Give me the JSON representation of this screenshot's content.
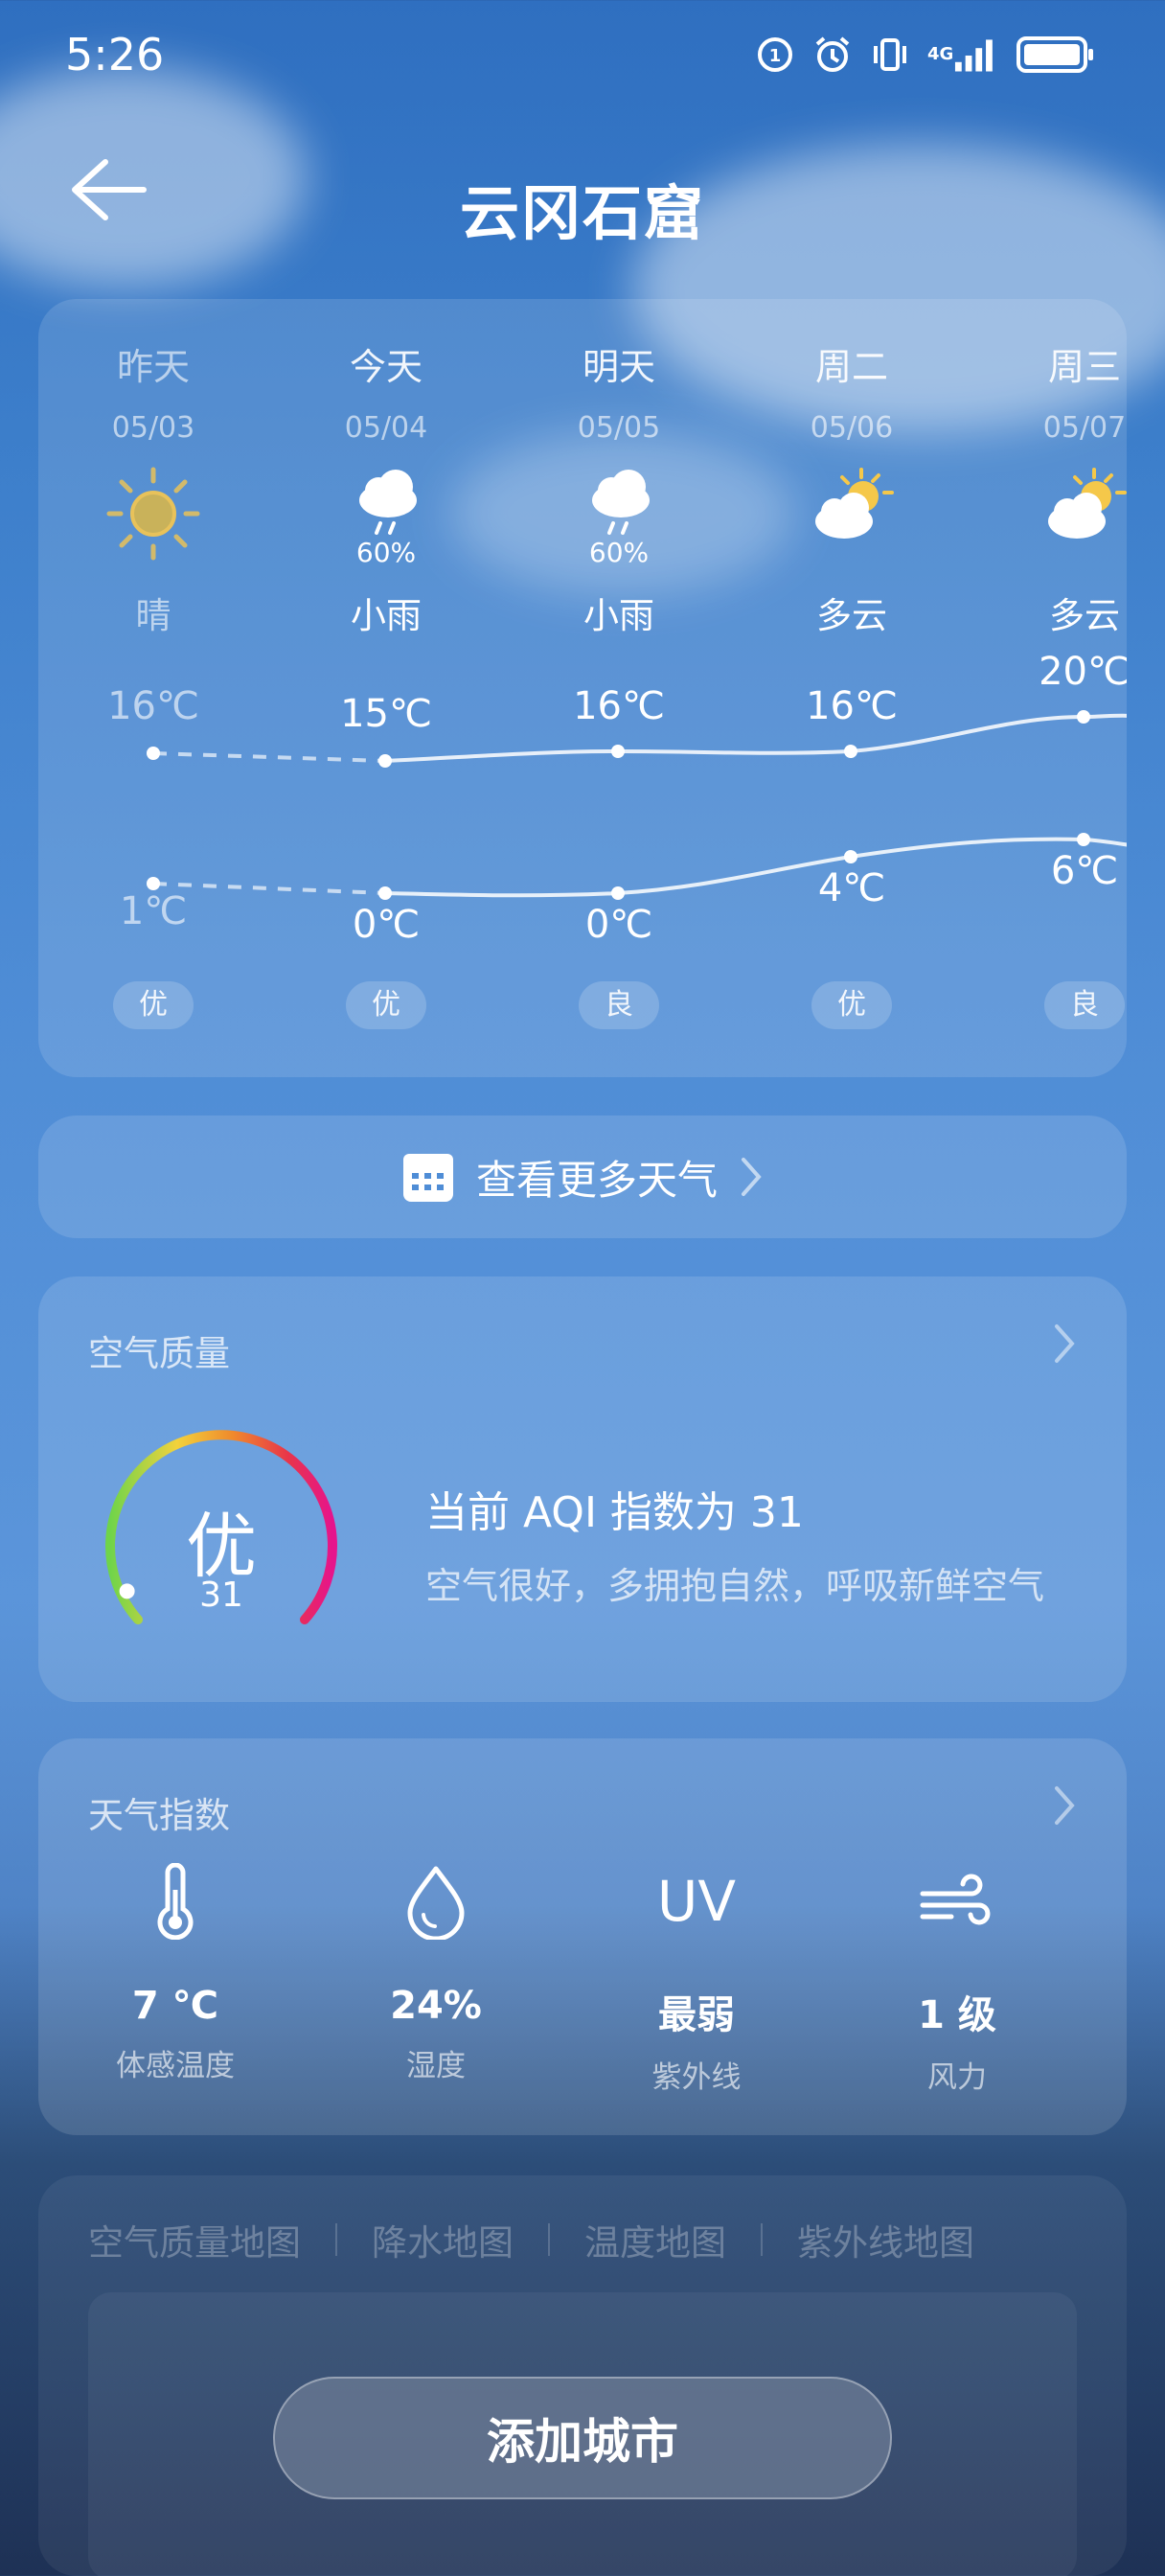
{
  "status_bar": {
    "time": "5:26",
    "network": "4G"
  },
  "header": {
    "title": "云冈石窟"
  },
  "forecast": [
    {
      "name": "昨天",
      "date": "05/03",
      "icon": "sun-icon",
      "precip": "",
      "condition": "晴",
      "high": "16℃",
      "low": "1℃",
      "aqi": "优"
    },
    {
      "name": "今天",
      "date": "05/04",
      "icon": "light-rain-icon",
      "precip": "60%",
      "condition": "小雨",
      "high": "15℃",
      "low": "0℃",
      "aqi": "优"
    },
    {
      "name": "明天",
      "date": "05/05",
      "icon": "light-rain-icon",
      "precip": "60%",
      "condition": "小雨",
      "high": "16℃",
      "low": "0℃",
      "aqi": "良"
    },
    {
      "name": "周二",
      "date": "05/06",
      "icon": "partly-cloudy-icon",
      "precip": "",
      "condition": "多云",
      "high": "16℃",
      "low": "4℃",
      "aqi": "优"
    },
    {
      "name": "周三",
      "date": "05/07",
      "icon": "partly-cloudy-icon",
      "precip": "",
      "condition": "多云",
      "high": "20℃",
      "low": "6℃",
      "aqi": "良"
    }
  ],
  "more_weather": {
    "label": "查看更多天气"
  },
  "air_quality": {
    "title": "空气质量",
    "level": "优",
    "aqi": "31",
    "aqi_scale_max": 500,
    "headline": "当前 AQI 指数为 31",
    "description": "空气很好，多拥抱自然，呼吸新鲜空气"
  },
  "weather_index": {
    "title": "天气指数",
    "items": [
      {
        "icon": "thermometer-icon",
        "value": "7 ℃",
        "label": "体感温度"
      },
      {
        "icon": "humidity-drop-icon",
        "value": "24%",
        "label": "湿度"
      },
      {
        "icon": "uv-icon",
        "icon_text": "UV",
        "value": "最弱",
        "label": "紫外线"
      },
      {
        "icon": "wind-icon",
        "value": "1 级",
        "label": "风力"
      }
    ]
  },
  "maps": {
    "tabs": [
      "空气质量地图",
      "降水地图",
      "温度地图",
      "紫外线地图"
    ]
  },
  "add_city": {
    "label": "添加城市"
  },
  "colors": {
    "accent_sun": "#f5c84a",
    "aqi_good": "#6fd44a",
    "aqi_bad": "#e6148c"
  }
}
